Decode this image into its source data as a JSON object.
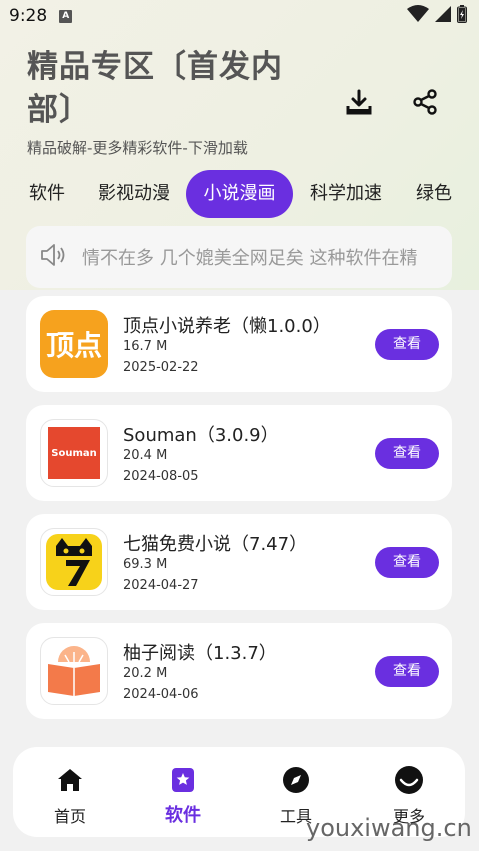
{
  "status_bar": {
    "time": "9:28",
    "notification_letter": "A"
  },
  "header": {
    "title_line1": "精品专区〔首发内",
    "title_line2": "部〕",
    "subtitle": "精品破解-更多精彩软件-下滑加载",
    "download_icon": "download-tray-icon",
    "share_icon": "share-icon"
  },
  "tabs": [
    {
      "label": "软件",
      "active": false
    },
    {
      "label": "影视动漫",
      "active": false
    },
    {
      "label": "小说漫画",
      "active": true
    },
    {
      "label": "科学加速",
      "active": false
    },
    {
      "label": "绿色",
      "active": false
    }
  ],
  "notice": {
    "icon": "speaker-icon",
    "text": "情不在多 几个媲美全网足矣  这种软件在精"
  },
  "apps": [
    {
      "name": "顶点小说养老（懒1.0.0）",
      "size": "16.7 M",
      "date": "2025-02-22",
      "button": "查看",
      "icon_text": "顶点"
    },
    {
      "name": "Souman（3.0.9）",
      "size": "20.4 M",
      "date": "2024-08-05",
      "button": "查看",
      "icon_text": "Souman"
    },
    {
      "name": "七猫免费小说（7.47）",
      "size": "69.3 M",
      "date": "2024-04-27",
      "button": "查看",
      "icon_text": "7"
    },
    {
      "name": "柚子阅读（1.3.7）",
      "size": "20.2 M",
      "date": "2024-04-06",
      "button": "查看",
      "icon_text": ""
    }
  ],
  "bottom_nav": [
    {
      "label": "首页",
      "icon": "home-icon",
      "active": false
    },
    {
      "label": "软件",
      "icon": "star-bookmark-icon",
      "active": true
    },
    {
      "label": "工具",
      "icon": "compass-icon",
      "active": false
    },
    {
      "label": "更多",
      "icon": "smiley-icon",
      "active": false
    }
  ],
  "watermark": "youxiwang.cn",
  "colors": {
    "accent": "#6a2fe0",
    "card": "#ffffff",
    "background": "#f1f1f1"
  }
}
